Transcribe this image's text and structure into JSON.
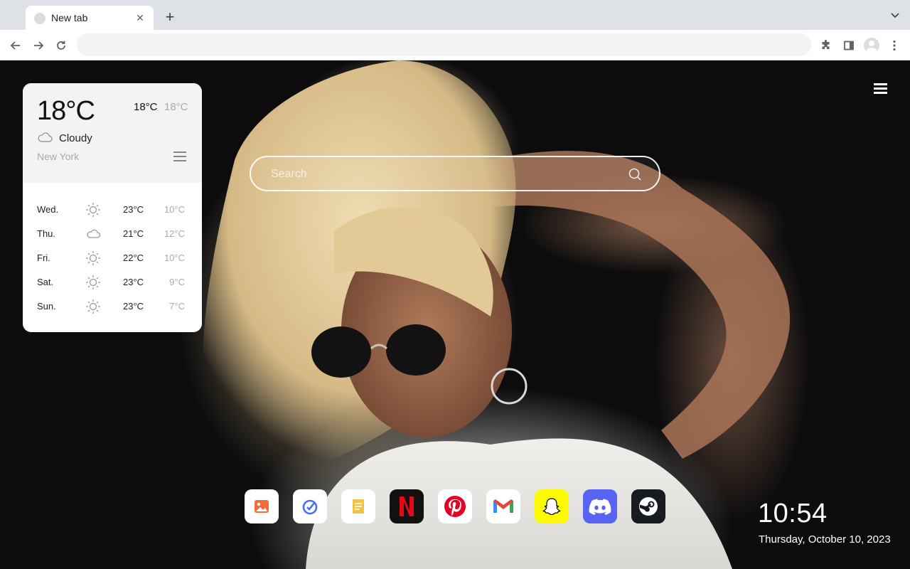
{
  "browser": {
    "tab_title": "New tab",
    "tab_close_icon": "close-icon",
    "new_tab_label": "+",
    "omnibox_value": "",
    "toolbar_icons": [
      "back-icon",
      "forward-icon",
      "reload-icon",
      "extensions-icon",
      "side-panel-icon",
      "profile-avatar-icon",
      "more-menu-icon"
    ]
  },
  "weather": {
    "current_temp": "18°C",
    "high": "18°C",
    "low": "18°C",
    "condition": "Cloudy",
    "condition_icon": "cloud-icon",
    "city": "New York",
    "forecast": [
      {
        "day": "Wed.",
        "icon": "sun-icon",
        "high": "23°C",
        "low": "10°C"
      },
      {
        "day": "Thu.",
        "icon": "cloud-icon",
        "high": "21°C",
        "low": "12°C"
      },
      {
        "day": "Fri.",
        "icon": "sun-icon",
        "high": "22°C",
        "low": "10°C"
      },
      {
        "day": "Sat.",
        "icon": "sun-icon",
        "high": "23°C",
        "low": "9°C"
      },
      {
        "day": "Sun.",
        "icon": "sun-icon",
        "high": "23°C",
        "low": "7°C"
      }
    ]
  },
  "search": {
    "placeholder": "Search",
    "icon": "search-icon"
  },
  "dock": {
    "apps": [
      "photos",
      "dida-todo",
      "notes",
      "netflix",
      "pinterest",
      "gmail",
      "snapchat",
      "discord",
      "steam"
    ],
    "colors": {
      "photos": "#f26b3a",
      "dida": "#4b6ef6",
      "notes": "#f5c242",
      "netflix": "#e50914",
      "pinterest": "#e60023",
      "snapchat": "#fffc00",
      "discord": "#5865f2",
      "steam": "#1b2838"
    }
  },
  "clock": {
    "time": "10:54",
    "date": "Thursday, October 10, 2023"
  }
}
